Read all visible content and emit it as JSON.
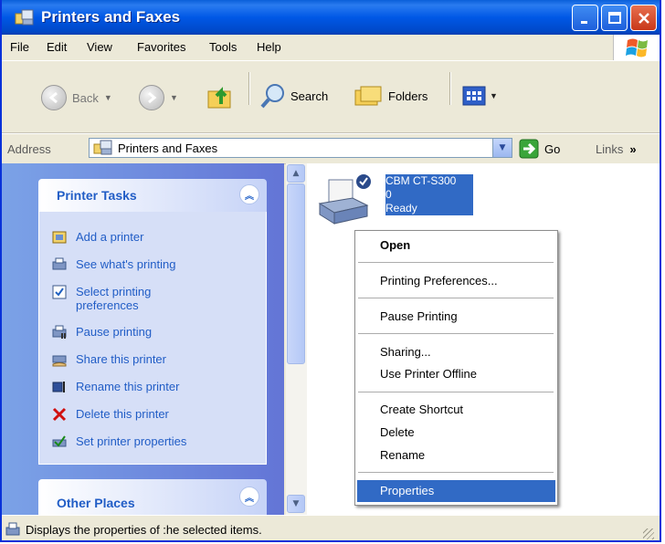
{
  "window": {
    "title": "Printers and Faxes"
  },
  "menubar": {
    "items": [
      "File",
      "Edit",
      "View",
      "Favorites",
      "Tools",
      "Help"
    ]
  },
  "toolbar": {
    "back": "Back",
    "search": "Search",
    "folders": "Folders"
  },
  "addressbar": {
    "label": "Address",
    "value": "Printers and Faxes",
    "go": "Go",
    "links": "Links"
  },
  "tasks": {
    "title": "Printer Tasks",
    "items": [
      {
        "label": "Add a printer",
        "icon": "add-printer-icon"
      },
      {
        "label": "See what's printing",
        "icon": "see-printing-icon"
      },
      {
        "label": "Select printing",
        "label2": "preferences",
        "icon": "preferences-icon"
      },
      {
        "label": "Pause printing",
        "icon": "pause-icon"
      },
      {
        "label": "Share this printer",
        "icon": "share-icon"
      },
      {
        "label": "Rename this printer",
        "icon": "rename-icon"
      },
      {
        "label": "Delete this printer",
        "icon": "delete-icon"
      },
      {
        "label": "Set printer properties",
        "icon": "properties-icon"
      }
    ]
  },
  "other_places": {
    "title": "Other Places"
  },
  "printer": {
    "name_line1": "CBM CT-S300",
    "name_line2": "0",
    "status": "Ready"
  },
  "context_menu": {
    "items": [
      "Open",
      "Printing Preferences...",
      "Pause Printing",
      "Sharing...",
      "Use Printer Offline",
      "Create Shortcut",
      "Delete",
      "Rename",
      "Properties"
    ],
    "highlighted": "Properties"
  },
  "statusbar": {
    "text": "Displays the properties of :he selected items."
  },
  "colors": {
    "title_bar": "#0058e6",
    "task_pane": "#6d8fde",
    "selection": "#316ac5",
    "link": "#215dc6"
  }
}
